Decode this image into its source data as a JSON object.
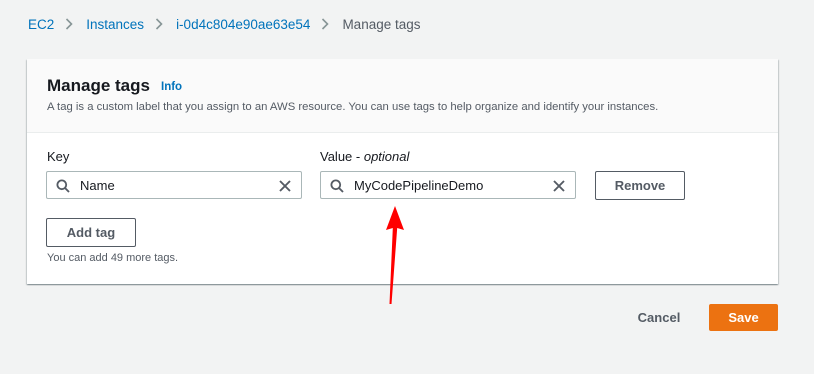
{
  "breadcrumb": {
    "items": [
      {
        "label": "EC2"
      },
      {
        "label": "Instances"
      },
      {
        "label": "i-0d4c804e90ae63e54"
      },
      {
        "label": "Manage tags"
      }
    ]
  },
  "panel": {
    "title": "Manage tags",
    "info_label": "Info",
    "description": "A tag is a custom label that you assign to an AWS resource. You can use tags to help organize and identify your instances."
  },
  "tag_row": {
    "key_label": "Key",
    "key_value": "Name",
    "value_label": "Value - ",
    "value_label_optional": "optional",
    "value_value": "MyCodePipelineDemo",
    "remove_label": "Remove"
  },
  "add_tag_label": "Add tag",
  "hint": "You can add 49 more tags.",
  "footer": {
    "cancel_label": "Cancel",
    "save_label": "Save"
  },
  "colors": {
    "link": "#0073bb",
    "primary": "#ec7211",
    "annotation_arrow": "#ff0000"
  },
  "icons": [
    "chevron-right-icon",
    "search-icon",
    "clear-icon",
    "red-arrow-annotation"
  ]
}
